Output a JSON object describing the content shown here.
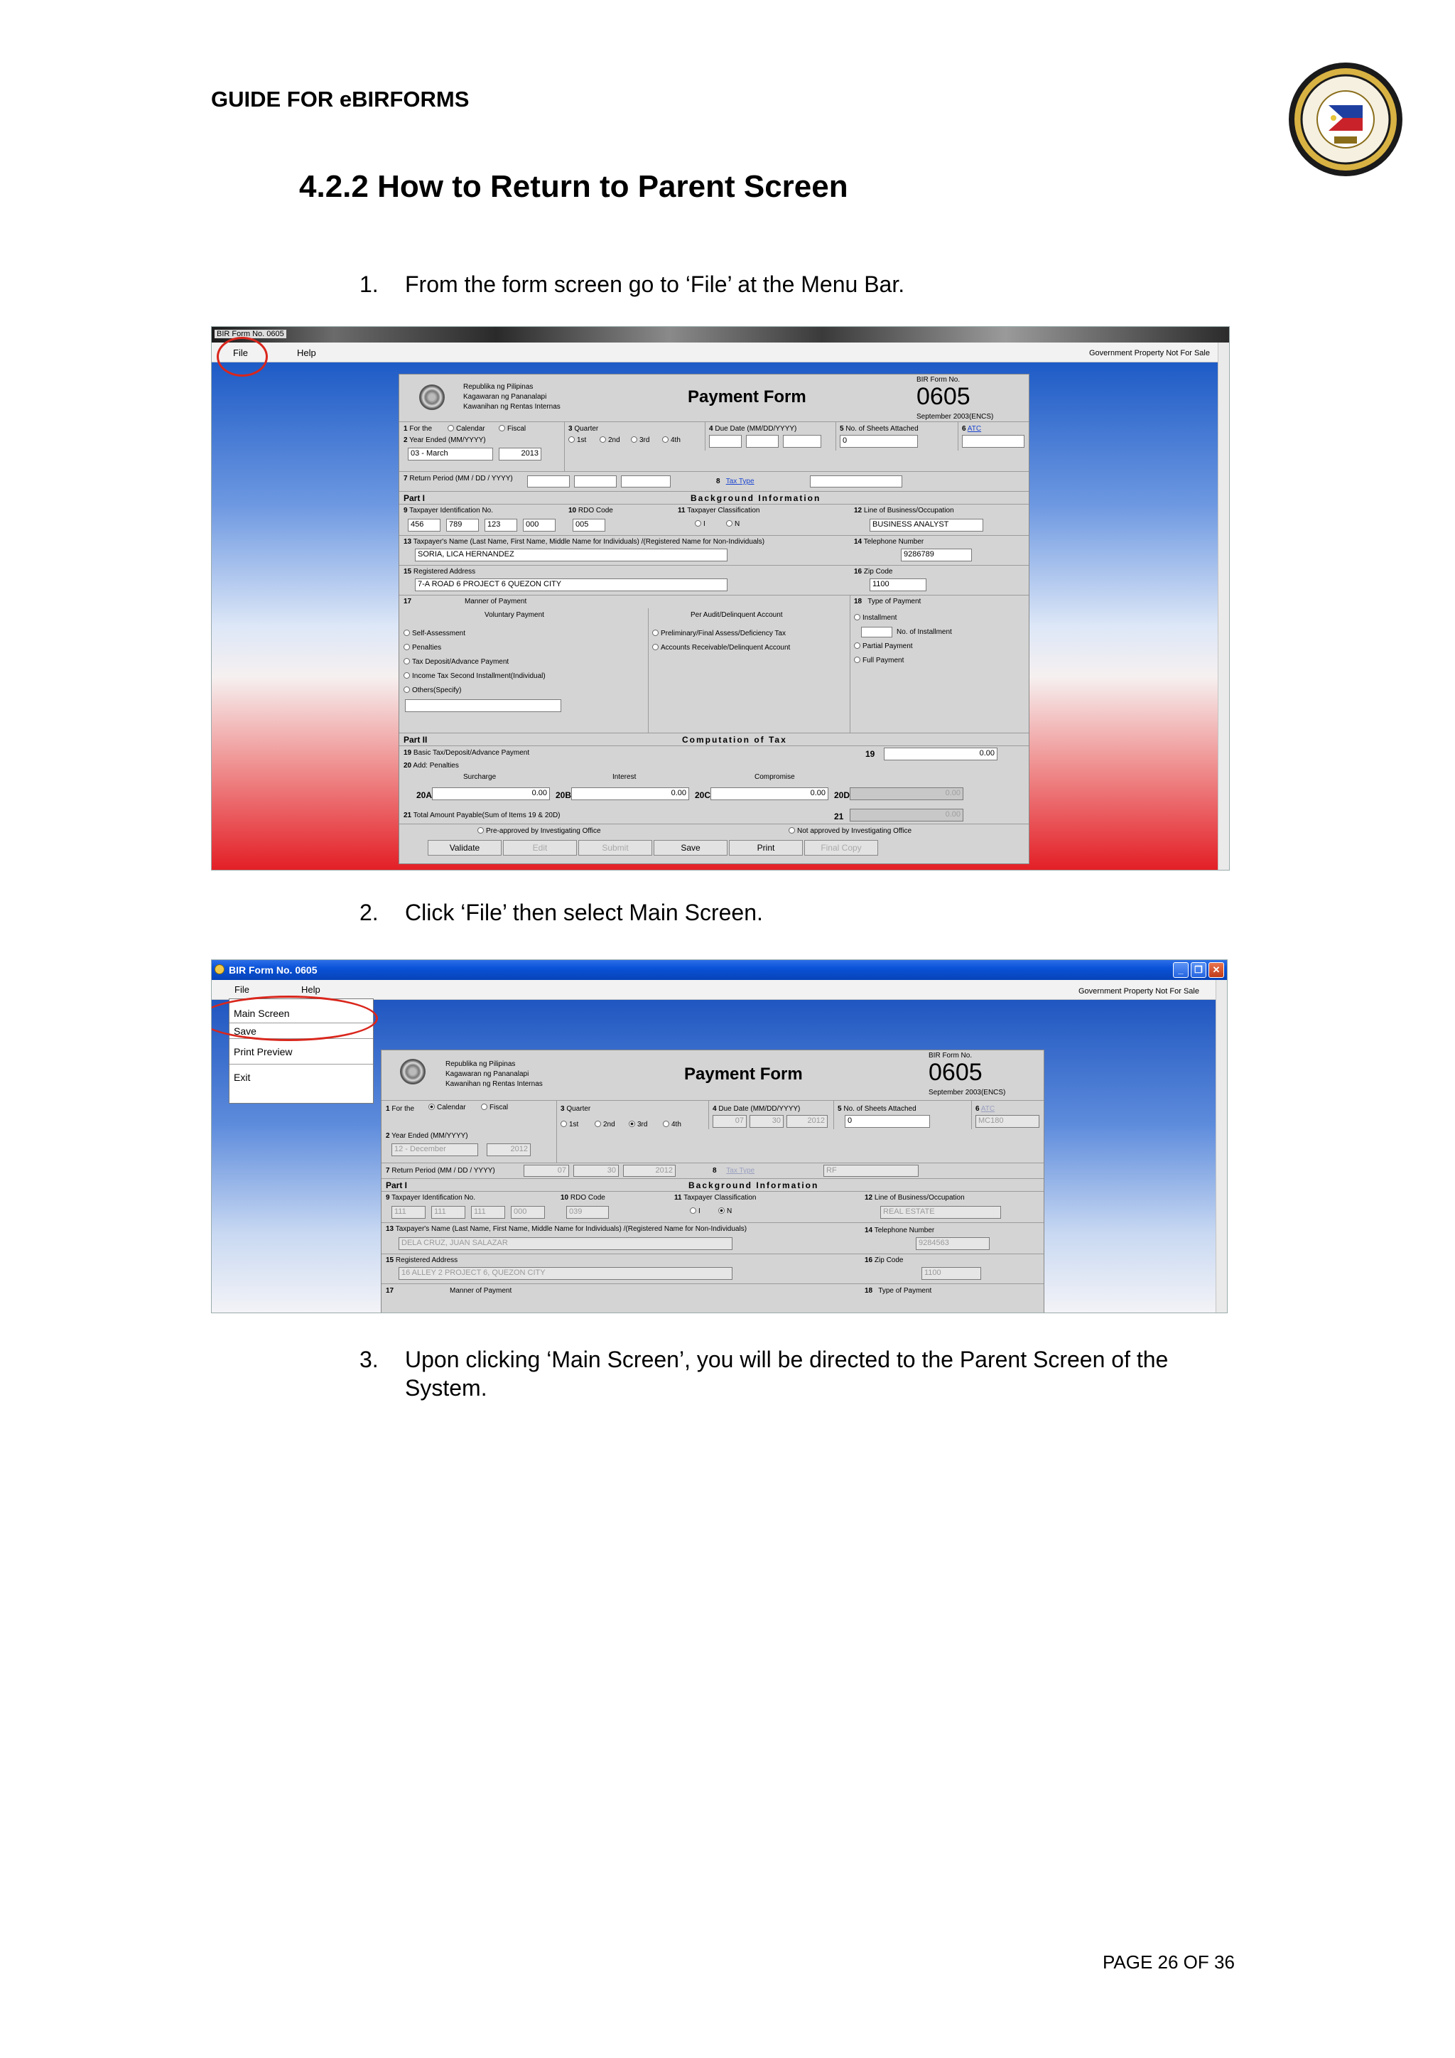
{
  "page": {
    "header": "GUIDE FOR eBIRFORMS",
    "section_title": "4.2.2  How to Return to Parent Screen",
    "steps": [
      {
        "num": "1.",
        "text": "From the form screen go to ‘File’ at the Menu Bar."
      },
      {
        "num": "2.",
        "text": "Click ‘File’ then select Main Screen."
      },
      {
        "num": "3.",
        "text": "Upon clicking ‘Main Screen’, you will be directed to the Parent Screen of the System."
      }
    ],
    "page_number": "PAGE 26 OF 36"
  },
  "shot1": {
    "window_title": "BIR Form No. 0605",
    "menu": {
      "file": "File",
      "help": "Help"
    },
    "gov_notice": "Government Property Not For Sale",
    "agency": [
      "Republika ng Pilipinas",
      "Kagawaran ng Pananalapi",
      "Kawanihan ng Rentas Internas"
    ],
    "form_title": "Payment Form",
    "form_no_label": "BIR Form No.",
    "form_no": "0605",
    "form_date": "September 2003(ENCS)",
    "f1": "1",
    "f1_label": "For the",
    "calendar": "Calendar",
    "fiscal": "Fiscal",
    "f2": "2",
    "f2_label": "Year Ended (MM/YYYY)",
    "month": "03 - March",
    "year": "2013",
    "f3": "3",
    "f3_label": "Quarter",
    "q1": "1st",
    "q2": "2nd",
    "q3": "3rd",
    "q4": "4th",
    "f4": "4",
    "f4_label": "Due Date (MM/DD/YYYY)",
    "f5": "5",
    "f5_label": "No. of Sheets Attached",
    "sheets": "0",
    "f6": "6",
    "atc": "ATC",
    "f7": "7",
    "f7_label": "Return Period (MM / DD / YYYY)",
    "f8": "8",
    "tax_type": "Tax Type",
    "part1": "Part I",
    "bg_info": "Background Information",
    "f9": "9",
    "f9_label": "Taxpayer Identification No.",
    "tin": [
      "456",
      "789",
      "123",
      "000"
    ],
    "f10": "10",
    "f10_label": "RDO Code",
    "rdo": "005",
    "f11": "11",
    "f11_label": "Taxpayer Classification",
    "cls_i": "I",
    "cls_n": "N",
    "f12": "12",
    "f12_label": "Line of Business/Occupation",
    "business": "BUSINESS ANALYST",
    "f13": "13",
    "f13_label": "Taxpayer's Name (Last Name, First Name, Middle Name for Individuals) /(Registered Name for Non-Individuals)",
    "name": "SORIA, LICA HERNANDEZ",
    "f14": "14",
    "f14_label": "Telephone Number",
    "phone": "9286789",
    "f15": "15",
    "f15_label": "Registered Address",
    "address": "7-A ROAD 6 PROJECT 6 QUEZON CITY",
    "f16": "16",
    "f16_label": "Zip Code",
    "zip": "1100",
    "f17": "17",
    "f17_label": "Manner of Payment",
    "f18": "18",
    "f18_label": "Type of Payment",
    "voluntary": "Voluntary Payment",
    "per_audit": "Per Audit/Delinquent Account",
    "vol_opts": [
      "Self-Assessment",
      "Penalties",
      "Tax Deposit/Advance Payment",
      "Income Tax Second Installment(Individual)",
      "Others(Specify)"
    ],
    "audit_opts": [
      "Preliminary/Final Assess/Deficiency Tax",
      "Accounts Receivable/Delinquent Account"
    ],
    "installment": "Installment",
    "no_installment": "No. of Installment",
    "partial": "Partial Payment",
    "full": "Full Payment",
    "part2": "Part II",
    "comp_tax": "Computation of Tax",
    "f19": "19",
    "f19_label": "Basic Tax/Deposit/Advance Payment",
    "f19_val": "0.00",
    "f20": "20",
    "f20_label": "Add: Penalties",
    "surcharge": "Surcharge",
    "interest": "Interest",
    "compromise": "Compromise",
    "f20a": "20A",
    "f20b": "20B",
    "f20c": "20C",
    "f20d": "20D",
    "v20a": "0.00",
    "v20b": "0.00",
    "v20c": "0.00",
    "v20d": "0.00",
    "f21": "21",
    "f21_label": "Total Amount Payable(Sum of Items 19 & 20D)",
    "v21": "0.00",
    "preapproved": "Pre-approved by Investigating Office",
    "notapproved": "Not approved by Investigating Office",
    "buttons": {
      "validate": "Validate",
      "edit": "Edit",
      "submit": "Submit",
      "save": "Save",
      "print": "Print",
      "final": "Final Copy"
    },
    "side_val": "19"
  },
  "shot2": {
    "window_title": "BIR Form No. 0605",
    "menu": {
      "file": "File",
      "help": "Help"
    },
    "dropdown": [
      "Main Screen",
      "Save",
      "Print Preview",
      "Exit"
    ],
    "gov_notice": "Government Property Not For Sale",
    "agency": [
      "Republika ng Pilipinas",
      "Kagawaran ng Pananalapi",
      "Kawanihan ng Rentas Internas"
    ],
    "form_title": "Payment Form",
    "form_no_label": "BIR Form No.",
    "form_no": "0605",
    "form_date": "September 2003(ENCS)",
    "f1": "1",
    "f1_label": "For the",
    "calendar": "Calendar",
    "fiscal": "Fiscal",
    "f2": "2",
    "f2_label": "Year Ended (MM/YYYY)",
    "month": "12 - December",
    "year": "2012",
    "f3": "3",
    "f3_label": "Quarter",
    "q1": "1st",
    "q2": "2nd",
    "q3": "3rd",
    "q4": "4th",
    "f4": "4",
    "f4_label": "Due Date (MM/DD/YYYY)",
    "due": [
      "07",
      "30",
      "2012"
    ],
    "f5": "5",
    "f5_label": "No. of Sheets Attached",
    "sheets": "0",
    "f6": "6",
    "atc": "ATC",
    "atc_val": "MC180",
    "f7": "7",
    "f7_label": "Return Period (MM / DD / YYYY)",
    "ret": [
      "07",
      "30",
      "2012"
    ],
    "f8": "8",
    "tax_type": "Tax Type",
    "tax_val": "RF",
    "part1": "Part I",
    "bg_info": "Background Information",
    "f9": "9",
    "f9_label": "Taxpayer Identification No.",
    "tin": [
      "111",
      "111",
      "111",
      "000"
    ],
    "f10": "10",
    "f10_label": "RDO Code",
    "rdo": "039",
    "f11": "11",
    "f11_label": "Taxpayer Classification",
    "cls_i": "I",
    "cls_n": "N",
    "f12": "12",
    "f12_label": "Line of Business/Occupation",
    "business": "REAL ESTATE",
    "f13": "13",
    "f13_label": "Taxpayer's Name (Last Name, First Name, Middle Name for Individuals) /(Registered Name for Non-Individuals)",
    "name": "DELA CRUZ, JUAN SALAZAR",
    "f14": "14",
    "f14_label": "Telephone Number",
    "phone": "9284563",
    "f15": "15",
    "f15_label": "Registered Address",
    "address": "16 ALLEY 2 PROJECT 6, QUEZON CITY",
    "f16": "16",
    "f16_label": "Zip Code",
    "zip": "1100",
    "f17": "17",
    "f17_label": "Manner of Payment",
    "f18": "18",
    "f18_label": "Type of Payment"
  }
}
